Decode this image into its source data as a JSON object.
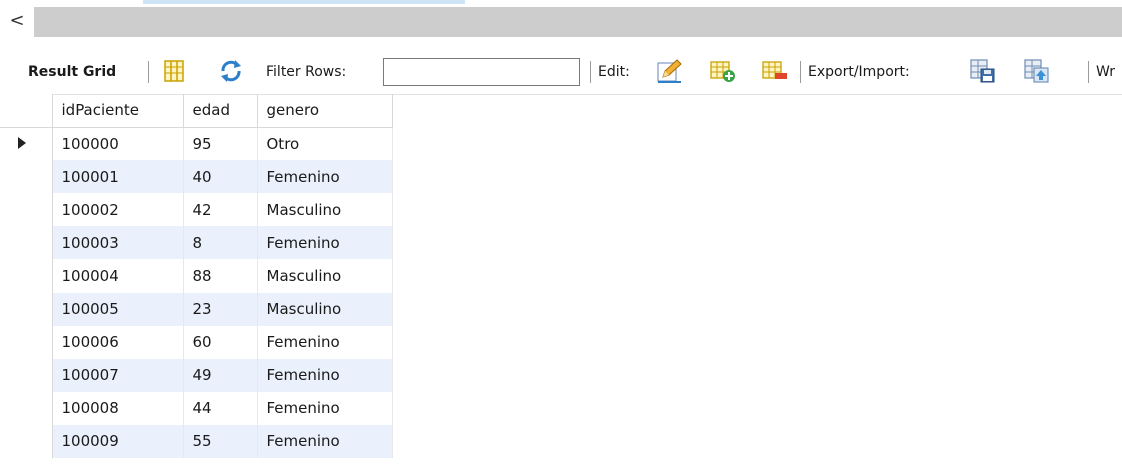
{
  "scrollbar": {
    "left_arrow": "<"
  },
  "toolbar": {
    "result_grid_label": "Result Grid",
    "filter_rows_label": "Filter Rows:",
    "filter_rows_value": "",
    "edit_label": "Edit:",
    "export_import_label": "Export/Import:",
    "wrap_label": "Wr"
  },
  "grid": {
    "columns": [
      "idPaciente",
      "edad",
      "genero"
    ],
    "rows": [
      [
        "100000",
        "95",
        "Otro"
      ],
      [
        "100001",
        "40",
        "Femenino"
      ],
      [
        "100002",
        "42",
        "Masculino"
      ],
      [
        "100003",
        "8",
        "Femenino"
      ],
      [
        "100004",
        "88",
        "Masculino"
      ],
      [
        "100005",
        "23",
        "Masculino"
      ],
      [
        "100006",
        "60",
        "Femenino"
      ],
      [
        "100007",
        "49",
        "Femenino"
      ],
      [
        "100008",
        "44",
        "Femenino"
      ],
      [
        "100009",
        "55",
        "Femenino"
      ]
    ],
    "selected_row": 0,
    "alt_row_color": "#eaf1fc"
  }
}
